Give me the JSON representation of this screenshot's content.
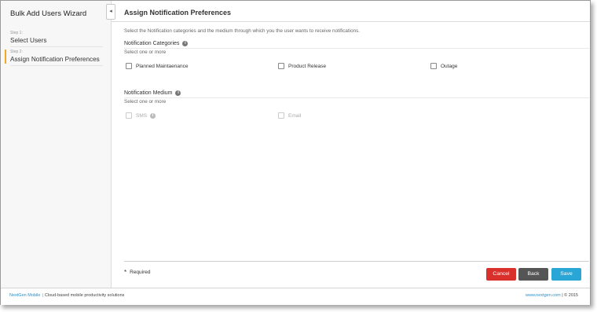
{
  "sidebar": {
    "wizard_title": "Bulk Add Users Wizard",
    "collapse_glyph": "◂",
    "steps": [
      {
        "number": "Step 1:",
        "label": "Select Users"
      },
      {
        "number": "Step 2:",
        "label": "Assign Notification Preferences"
      }
    ],
    "active_step": 2
  },
  "main": {
    "title": "Assign Notification Preferences",
    "intro": "Select the Notification categories and the medium through which you the user wants to receive notifications.",
    "categories": {
      "title": "Notification Categories",
      "subtitle": "Select one or more",
      "options": [
        "Planned Maintaenance",
        "Product Release",
        "Outage"
      ]
    },
    "medium": {
      "title": "Notification Medium",
      "subtitle": "Select one or more",
      "options": [
        "SMS",
        "Email"
      ]
    },
    "info_glyph": "i",
    "required_star": "*",
    "required_label": "Required",
    "buttons": {
      "cancel": "Cancel",
      "back": "Back",
      "save": "Save"
    }
  },
  "footer": {
    "brand": "NextGen Mobile",
    "separator": "|",
    "tagline": "Cloud-based mobile productivity solutions",
    "site": "www.nextgen.com",
    "copyright": "| © 2015"
  },
  "colors": {
    "active_step": "#f5a623",
    "cancel": "#d9302c",
    "back": "#555555",
    "save": "#2aa6d6",
    "link": "#2a8fc9"
  }
}
